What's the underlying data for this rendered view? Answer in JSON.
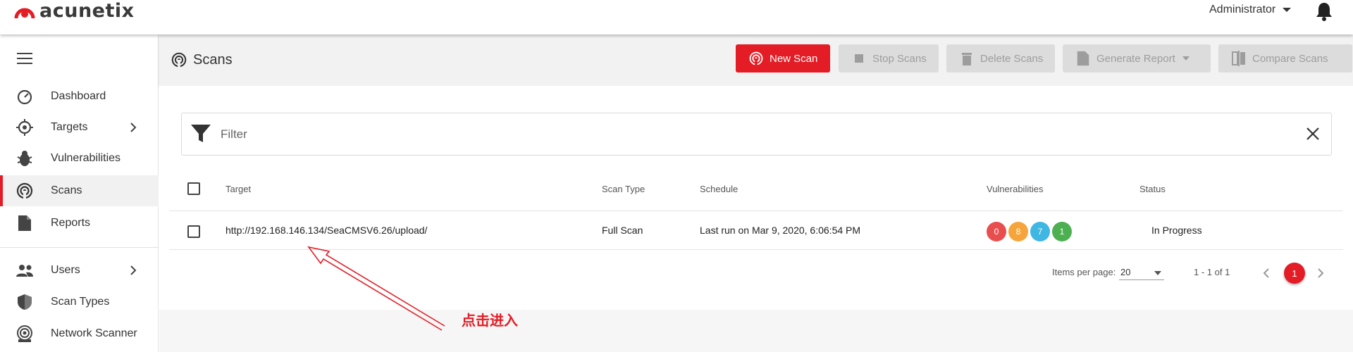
{
  "app": {
    "logo_text": "acunetix",
    "accent_color": "#e31c25"
  },
  "topbar": {
    "user": "Administrator",
    "bell_icon": "bell-icon"
  },
  "sidebar": {
    "items": [
      {
        "label": "Dashboard",
        "icon": "dashboard-icon"
      },
      {
        "label": "Targets",
        "icon": "target-icon"
      },
      {
        "label": "Vulnerabilities",
        "icon": "bug-icon"
      },
      {
        "label": "Scans",
        "icon": "scan-icon"
      },
      {
        "label": "Reports",
        "icon": "report-icon"
      },
      {
        "label": "Users",
        "icon": "users-icon"
      },
      {
        "label": "Scan Types",
        "icon": "shield-icon"
      },
      {
        "label": "Network Scanner",
        "icon": "network-scanner-icon"
      }
    ]
  },
  "header": {
    "title": "Scans",
    "buttons": {
      "new_scan": "New Scan",
      "stop_scans": "Stop Scans",
      "delete_scans": "Delete Scans",
      "generate_report": "Generate Report",
      "compare_scans": "Compare Scans"
    }
  },
  "filter": {
    "label": "Filter"
  },
  "table": {
    "columns": {
      "target": "Target",
      "scan_type": "Scan Type",
      "schedule": "Schedule",
      "vulnerabilities": "Vulnerabilities",
      "status": "Status"
    },
    "rows": [
      {
        "target": "http://192.168.146.134/SeaCMSV6.26/upload/",
        "scan_type": "Full Scan",
        "schedule": "Last run on Mar 9, 2020, 6:06:54 PM",
        "vulns": [
          {
            "count": "0",
            "color": "#e94e4e"
          },
          {
            "count": "8",
            "color": "#f5a53b"
          },
          {
            "count": "7",
            "color": "#40b6e3"
          },
          {
            "count": "1",
            "color": "#4caf50"
          }
        ],
        "status": "In Progress"
      }
    ]
  },
  "pagination": {
    "items_per_page_label": "Items per page:",
    "items_per_page": "20",
    "range": "1 - 1 of 1",
    "current_page": "1"
  },
  "annotation": {
    "text": "点击进入",
    "color": "#e31c25"
  }
}
